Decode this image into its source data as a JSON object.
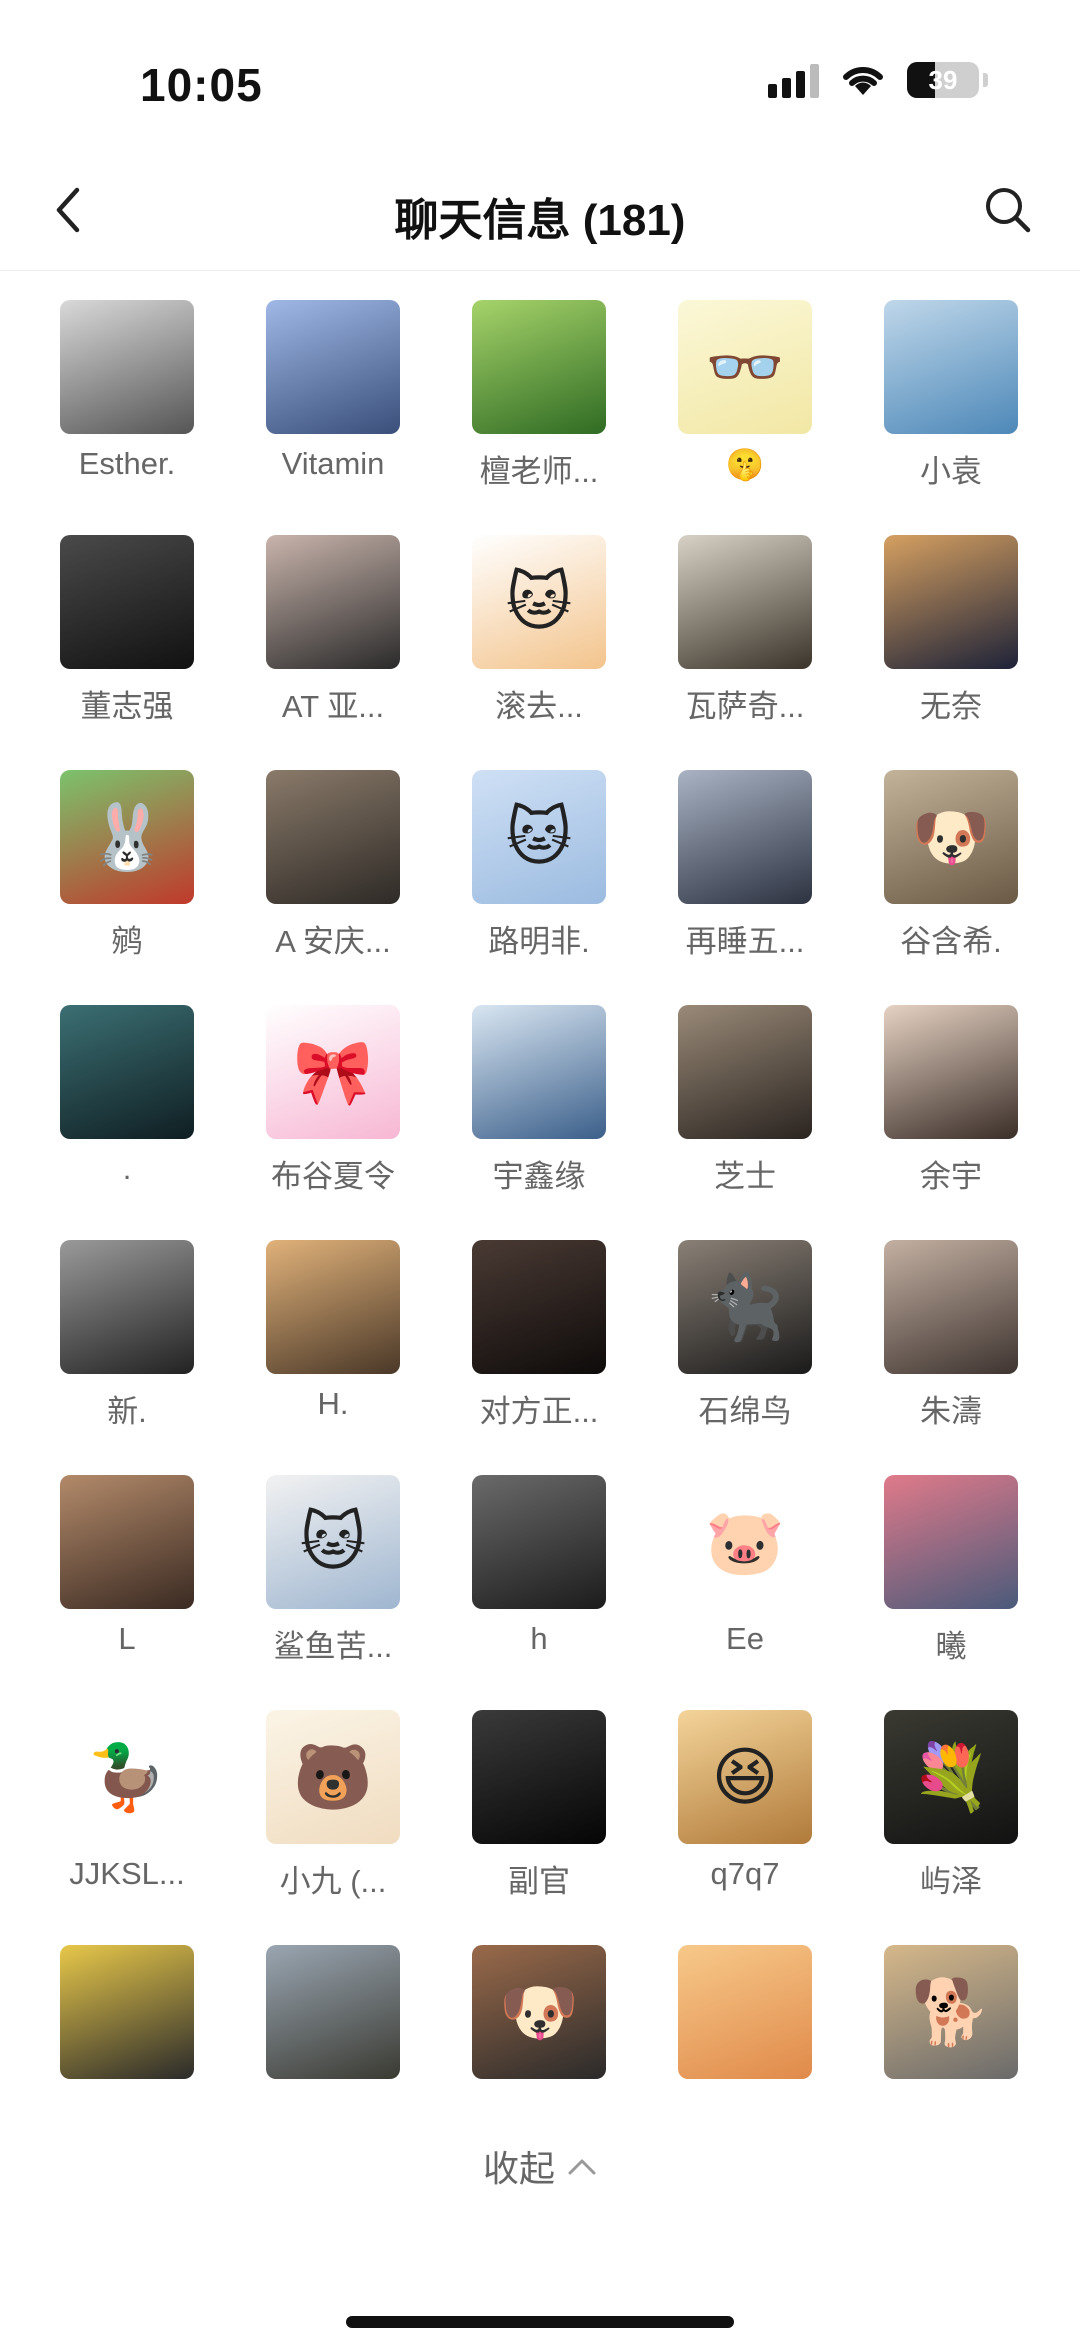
{
  "status": {
    "time": "10:05",
    "battery_level": 39,
    "battery": "39"
  },
  "nav": {
    "title": "聊天信息 (181)",
    "back_icon": "chevron-left-icon",
    "search_icon": "search-icon"
  },
  "members": [
    [
      {
        "name": "Esther.",
        "colors": [
          "#d9d9d9",
          "#555555"
        ]
      },
      {
        "name": "Vitamin",
        "colors": [
          "#9fb8e6",
          "#3a4f7a"
        ]
      },
      {
        "name": "檀老师...",
        "colors": [
          "#a6d36a",
          "#2f6b23"
        ]
      },
      {
        "name": "🤫",
        "colors": [
          "#fbf8d8",
          "#f2e7a4"
        ],
        "glyph": "👓"
      },
      {
        "name": "小袁",
        "colors": [
          "#bfd7ea",
          "#4d88b8"
        ]
      }
    ],
    [
      {
        "name": "董志强",
        "colors": [
          "#4a4a4a",
          "#111111"
        ]
      },
      {
        "name": "AT 亚...",
        "colors": [
          "#c9b4ac",
          "#2a2a2a"
        ]
      },
      {
        "name": "滚去...",
        "colors": [
          "#ffffff",
          "#f3c48c"
        ],
        "glyph": "🐱"
      },
      {
        "name": "瓦萨奇...",
        "colors": [
          "#d8d2c6",
          "#3a342a"
        ]
      },
      {
        "name": "无奈",
        "colors": [
          "#d6a061",
          "#1d2238"
        ]
      }
    ],
    [
      {
        "name": "鹓",
        "colors": [
          "#7bc36d",
          "#c0392b"
        ],
        "glyph": "🐰"
      },
      {
        "name": "A 安庆...",
        "colors": [
          "#8a7a6a",
          "#2e2a26"
        ]
      },
      {
        "name": "路明非.",
        "colors": [
          "#cfe0f5",
          "#9bbbe0"
        ],
        "glyph": "🐱"
      },
      {
        "name": "再睡五...",
        "colors": [
          "#a9b3c4",
          "#2c3240"
        ]
      },
      {
        "name": "谷含希.",
        "colors": [
          "#c3b39a",
          "#6a5a45"
        ],
        "glyph": "🐶"
      }
    ],
    [
      {
        "name": ".",
        "colors": [
          "#3b6f73",
          "#0f1e22"
        ]
      },
      {
        "name": "布谷夏令",
        "colors": [
          "#ffffff",
          "#f7b7d4"
        ],
        "glyph": "🎀"
      },
      {
        "name": "宇鑫缘",
        "colors": [
          "#d9e6f2",
          "#3b5f8a"
        ]
      },
      {
        "name": "芝士",
        "colors": [
          "#9a8a78",
          "#2a2420"
        ]
      },
      {
        "name": "余宇",
        "colors": [
          "#e6d2c3",
          "#3a2e28"
        ]
      }
    ],
    [
      {
        "name": "新.",
        "colors": [
          "#9a9a9a",
          "#222222"
        ]
      },
      {
        "name": "H.",
        "colors": [
          "#e1b27a",
          "#4a3828"
        ]
      },
      {
        "name": "对方正...",
        "colors": [
          "#4a3a34",
          "#0e0b0a"
        ]
      },
      {
        "name": "石绵鸟",
        "colors": [
          "#8a8076",
          "#1a1a1a"
        ],
        "glyph": "🐈‍⬛"
      },
      {
        "name": "朱濤",
        "colors": [
          "#c4b0a2",
          "#3e3430"
        ]
      }
    ],
    [
      {
        "name": "L",
        "colors": [
          "#b38a6a",
          "#3a2a22"
        ]
      },
      {
        "name": "鲨鱼苦...",
        "colors": [
          "#f2f2f2",
          "#9fb6d0"
        ],
        "glyph": "🐱"
      },
      {
        "name": "h",
        "colors": [
          "#6a6a6a",
          "#1c1c1c"
        ]
      },
      {
        "name": "Ee",
        "colors": [
          "#ffffff",
          "#ffffff"
        ],
        "glyph": "🐷"
      },
      {
        "name": "曦",
        "colors": [
          "#e07a8a",
          "#4a5a7a"
        ]
      }
    ],
    [
      {
        "name": "JJKSL...",
        "colors": [
          "#ffffff",
          "#ffffff"
        ],
        "glyph": "🦆"
      },
      {
        "name": "小九 (...",
        "colors": [
          "#fbf4e6",
          "#f0dcc0"
        ],
        "glyph": "🐻"
      },
      {
        "name": "副官",
        "colors": [
          "#3a3a3a",
          "#050505"
        ]
      },
      {
        "name": "q7q7",
        "colors": [
          "#f4d49a",
          "#b07a3a"
        ],
        "glyph": "😆"
      },
      {
        "name": "屿泽",
        "colors": [
          "#3a3a32",
          "#121212"
        ],
        "glyph": "💐"
      }
    ],
    [
      {
        "name": "",
        "colors": [
          "#e8c84a",
          "#2a2a2a"
        ]
      },
      {
        "name": "",
        "colors": [
          "#9aa6b2",
          "#3a3a32"
        ]
      },
      {
        "name": "",
        "colors": [
          "#9a6a4a",
          "#2a2a2a"
        ],
        "glyph": "🐶"
      },
      {
        "name": "",
        "colors": [
          "#f7c98a",
          "#e08a4a"
        ]
      },
      {
        "name": "",
        "colors": [
          "#d6b88a",
          "#6a6a6a"
        ],
        "glyph": "🐕"
      }
    ]
  ],
  "collapse": {
    "label": "收起",
    "icon": "chevron-up-icon"
  }
}
